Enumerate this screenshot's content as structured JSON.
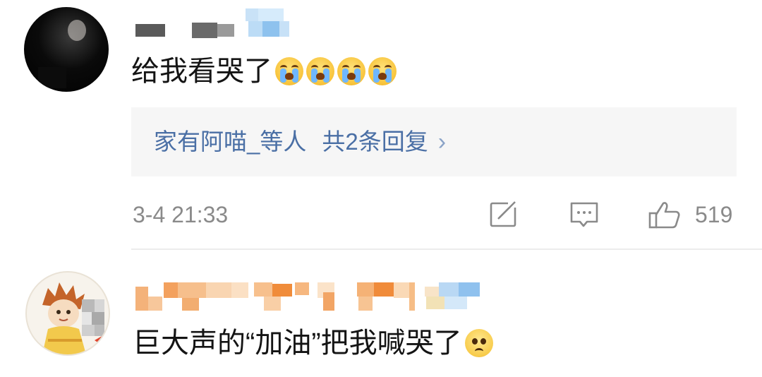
{
  "comment1": {
    "avatar": "blurred-user-avatar",
    "text": "给我看哭了",
    "emoji": "loudly-crying-face",
    "emoji_count": 4,
    "reply_preview": {
      "author": "家有阿喵_等人",
      "summary": "共2条回复",
      "chevron": "›"
    },
    "timestamp": "3-4 21:33",
    "actions": {
      "share_icon": "edit-share-icon",
      "comment_icon": "comment-icon",
      "like_icon": "thumbs-up-icon",
      "like_count": "519"
    }
  },
  "comment2": {
    "avatar": "cartoon-character-avatar",
    "text": "巨大声的“加油”把我喊哭了",
    "emoji": "pleading-face"
  },
  "colors": {
    "link_blue": "#4a6fa5",
    "meta_gray": "#8a8a8a",
    "reply_bg": "#f6f6f6"
  }
}
